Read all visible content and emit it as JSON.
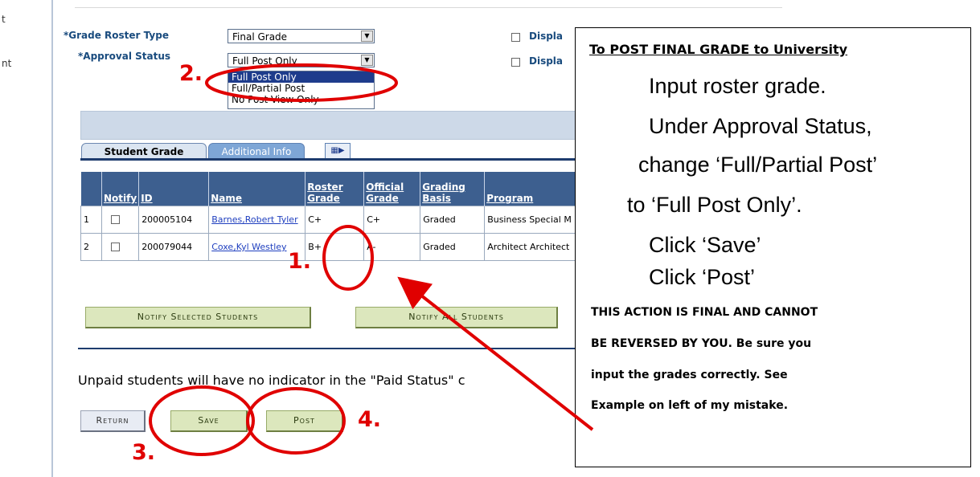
{
  "nav": {
    "fragments": [
      "t",
      "nt"
    ]
  },
  "form": {
    "grade_roster_type_label": "*Grade Roster Type",
    "grade_roster_type_value": "Final Grade",
    "approval_status_label": "*Approval Status",
    "approval_status_value": "Full Post Only",
    "approval_options": [
      "Full Post Only",
      "Full/Partial Post",
      "No Post-View Only"
    ],
    "display_label_1": "Displa",
    "display_label_2": "Displa"
  },
  "tabs": {
    "student_grade": "Student Grade",
    "additional_info": "Additional Info"
  },
  "table": {
    "headers": [
      "",
      "Notify",
      "ID",
      "Name",
      "Roster Grade",
      "Official Grade",
      "Grading Basis",
      "Program"
    ],
    "rows": [
      {
        "num": "1",
        "id": "200005104",
        "name": "Barnes,Robert Tyler",
        "roster": "C+",
        "official": "C+",
        "basis": "Graded",
        "program": "Business Special M"
      },
      {
        "num": "2",
        "id": "200079044",
        "name": "Coxe,Kyl Westley",
        "roster": "B+",
        "official": "A-",
        "basis": "Graded",
        "program": "Architect Architect"
      }
    ]
  },
  "buttons": {
    "notify_selected": "Notify Selected Students",
    "notify_all": "Notify All Students",
    "return": "Return",
    "save": "Save",
    "post": "Post"
  },
  "unpaid_note": "Unpaid students will have no indicator in the \"Paid Status\" c",
  "annotations": {
    "step1": "1.",
    "step2": "2.",
    "step3": "3.",
    "step4": "4.",
    "color": "#e00000"
  },
  "callout": {
    "title": "To POST FINAL GRADE to University",
    "lines": [
      "Input roster grade.",
      "Under Approval Status,",
      "change ‘Full/Partial Post’",
      "to ‘Full Post Only’.",
      "Click ‘Save’",
      "Click ‘Post’"
    ],
    "warning": [
      "THIS ACTION IS FINAL AND CANNOT",
      "BE REVERSED BY YOU.  Be sure you",
      "input the grades correctly.  See",
      "Example on left of my mistake."
    ]
  }
}
